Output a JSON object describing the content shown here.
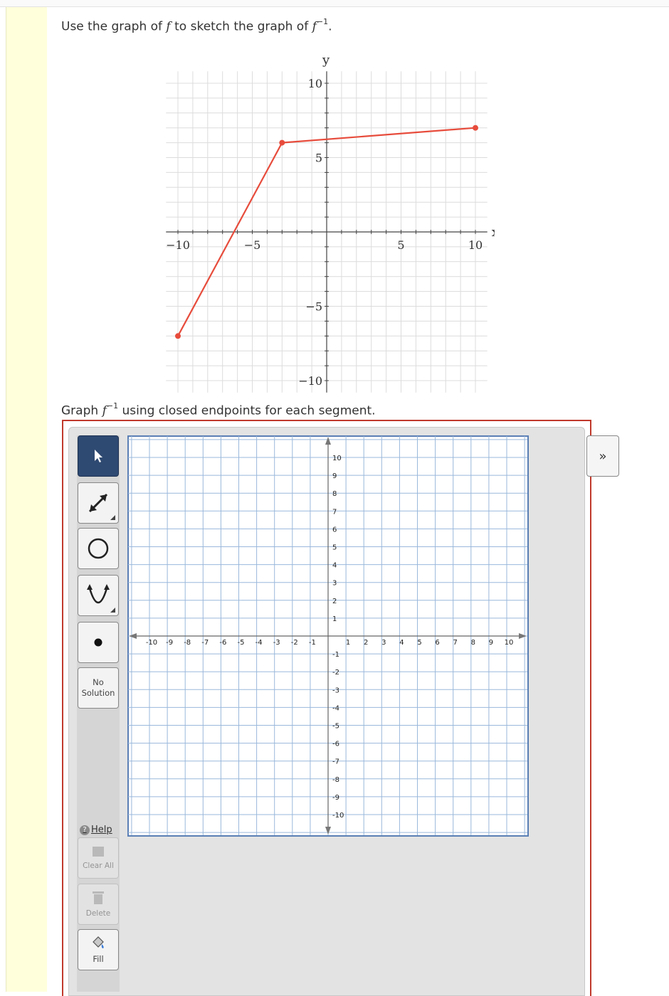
{
  "question": {
    "prefix": "Use the graph of ",
    "f": "f",
    "middle": " to sketch the graph of ",
    "f2": "f",
    "sup": "−1",
    "suffix": "."
  },
  "prompt": {
    "prefix": "Graph ",
    "f": "f",
    "sup": "−1",
    "suffix": " using closed endpoints for each segment."
  },
  "given_graph": {
    "x_label": "x",
    "y_label": "y",
    "x_ticks": [
      "−10",
      "−5",
      "5",
      "10"
    ],
    "y_ticks": [
      "10",
      "5",
      "−5",
      "−10"
    ],
    "line_color": "#e74c3c",
    "points": [
      [
        -10,
        -7
      ],
      [
        -3,
        6
      ],
      [
        10,
        7
      ]
    ]
  },
  "entry_graph": {
    "x_ticks": [
      "-10",
      "-9",
      "-8",
      "-7",
      "-6",
      "-5",
      "-4",
      "-3",
      "-2",
      "-1",
      "1",
      "2",
      "3",
      "4",
      "5",
      "6",
      "7",
      "8",
      "9",
      "10"
    ],
    "y_ticks": [
      "10",
      "9",
      "8",
      "7",
      "6",
      "5",
      "4",
      "3",
      "2",
      "1",
      "-1",
      "-2",
      "-3",
      "-4",
      "-5",
      "-6",
      "-7",
      "-8",
      "-9",
      "-10"
    ],
    "grid_color": "#9ab8db",
    "frame_color": "#5a7fb5"
  },
  "toolbar": {
    "no_solution_line1": "No",
    "no_solution_line2": "Solution",
    "help_label": "Help",
    "clear_all_label": "Clear All",
    "delete_label": "Delete",
    "fill_label": "Fill",
    "expand_label": "»"
  },
  "colors": {
    "frame_red": "#c0392b",
    "active_tool": "#2f4a72"
  }
}
